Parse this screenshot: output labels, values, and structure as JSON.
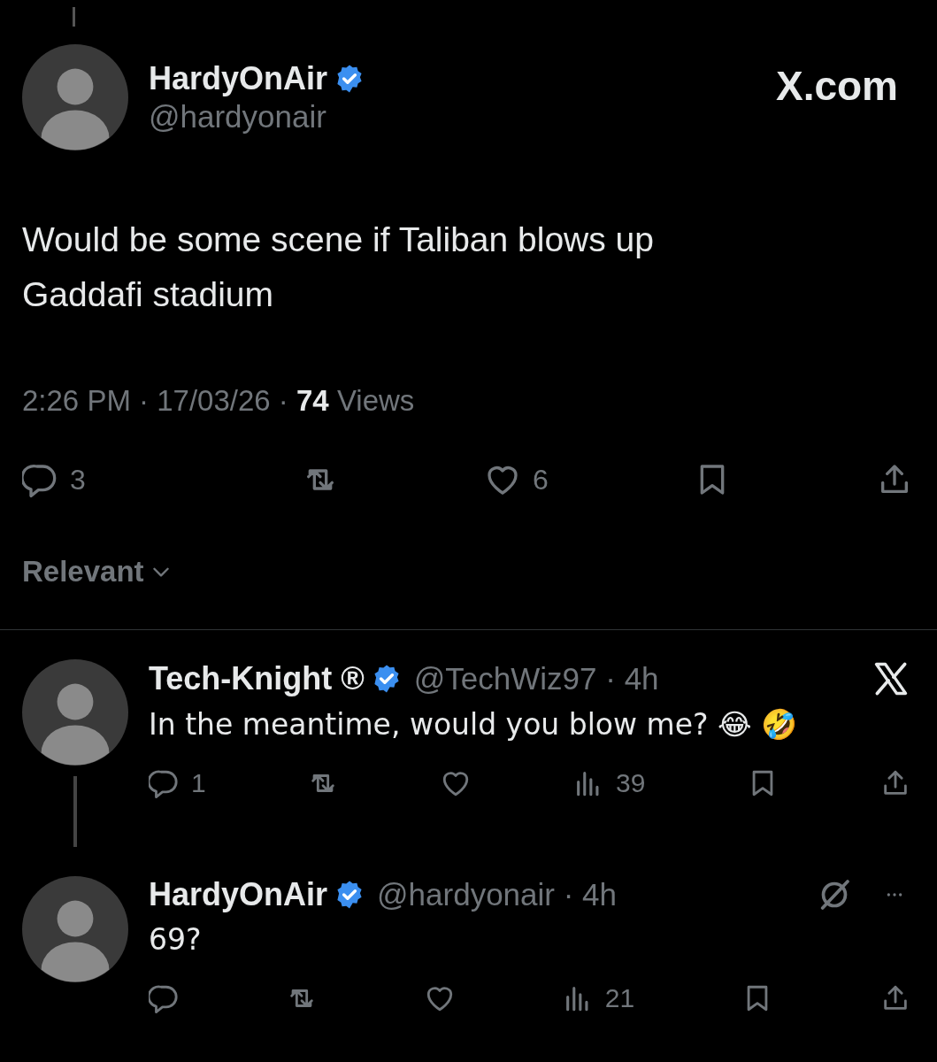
{
  "post": {
    "author": {
      "name": "HardyOnAir",
      "verified": true,
      "handle": "@hardyonair"
    },
    "site_label": "X.com",
    "text": "Would be some scene if Taliban blows up Gaddafi stadium",
    "meta": {
      "time": "2:26 PM",
      "sep_1": "·",
      "date": "17/03/26",
      "sep_2": "·",
      "views_count": "74",
      "views_label": "Views"
    },
    "actions": [
      {
        "kind": "reply",
        "count": "3"
      },
      {
        "kind": "repost"
      },
      {
        "kind": "like",
        "count": "6"
      },
      {
        "kind": "bookmark"
      },
      {
        "kind": "share"
      }
    ]
  },
  "sort": {
    "label": "Relevant"
  },
  "replies": [
    {
      "name": "Tech-Knight ®",
      "verified": true,
      "handle": "@TechWiz97",
      "separator": "·",
      "age": "4h",
      "text": "In the meantime, would you blow me? 😂 🤣",
      "thread_below": true,
      "corner_icons": [
        {
          "kind": "x-logo"
        }
      ],
      "actions": [
        {
          "kind": "reply",
          "count": "1"
        },
        {
          "kind": "repost"
        },
        {
          "kind": "like"
        },
        {
          "kind": "views",
          "count": "39"
        },
        {
          "kind": "bookmark"
        },
        {
          "kind": "share"
        }
      ]
    },
    {
      "name": "HardyOnAir",
      "verified": true,
      "handle": "@hardyonair",
      "separator": "·",
      "age": "4h",
      "text": "69?",
      "thread_below": false,
      "corner_icons": [
        {
          "kind": "grok"
        },
        {
          "kind": "more"
        }
      ],
      "actions": [
        {
          "kind": "reply"
        },
        {
          "kind": "repost"
        },
        {
          "kind": "like"
        },
        {
          "kind": "views",
          "count": "21"
        },
        {
          "kind": "bookmark"
        },
        {
          "kind": "share"
        }
      ]
    }
  ]
}
